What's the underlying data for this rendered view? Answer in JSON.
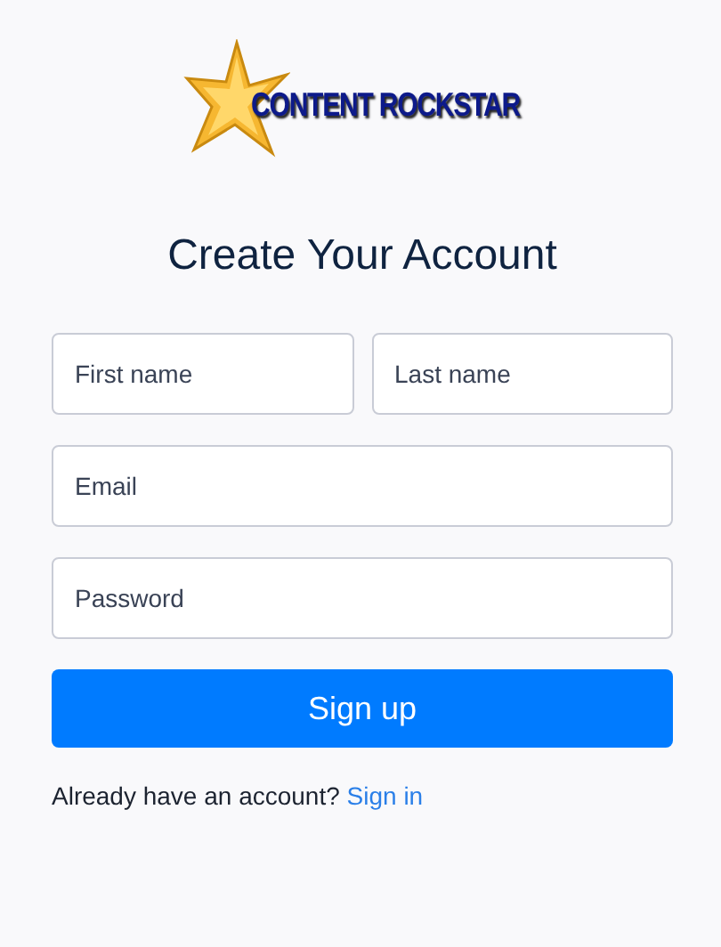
{
  "logo": {
    "text": "CONTENT ROCKSTAR"
  },
  "title": "Create Your Account",
  "fields": [
    {
      "placeholder": "First name",
      "half": true
    },
    {
      "placeholder": "Last name",
      "half": true
    },
    {
      "placeholder": "Email",
      "half": false
    },
    {
      "placeholder": "Password",
      "half": false
    }
  ],
  "submit": "Sign up",
  "footer": {
    "text": "Already have an account?",
    "link": "Sign in"
  }
}
